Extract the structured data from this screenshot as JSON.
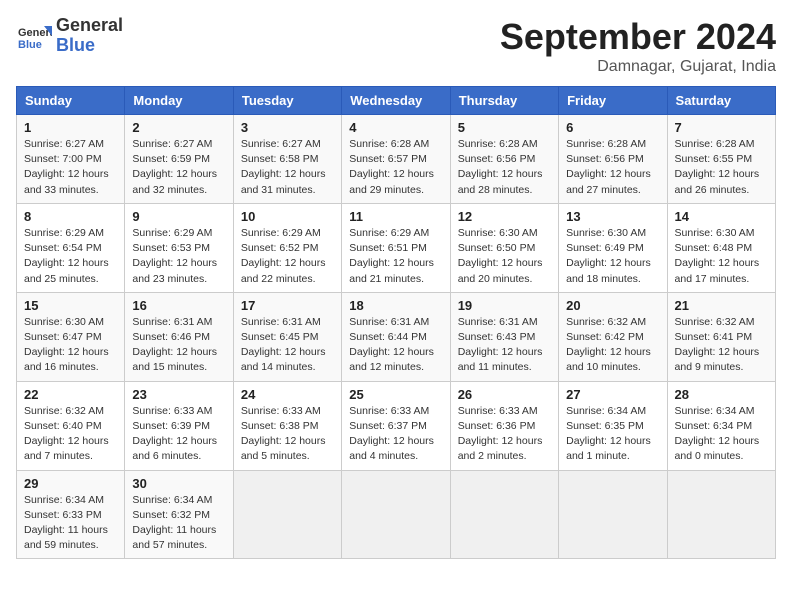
{
  "header": {
    "logo_line1": "General",
    "logo_line2": "Blue",
    "month": "September 2024",
    "location": "Damnagar, Gujarat, India"
  },
  "columns": [
    "Sunday",
    "Monday",
    "Tuesday",
    "Wednesday",
    "Thursday",
    "Friday",
    "Saturday"
  ],
  "weeks": [
    [
      {
        "day": "1",
        "info": "Sunrise: 6:27 AM\nSunset: 7:00 PM\nDaylight: 12 hours\nand 33 minutes."
      },
      {
        "day": "2",
        "info": "Sunrise: 6:27 AM\nSunset: 6:59 PM\nDaylight: 12 hours\nand 32 minutes."
      },
      {
        "day": "3",
        "info": "Sunrise: 6:27 AM\nSunset: 6:58 PM\nDaylight: 12 hours\nand 31 minutes."
      },
      {
        "day": "4",
        "info": "Sunrise: 6:28 AM\nSunset: 6:57 PM\nDaylight: 12 hours\nand 29 minutes."
      },
      {
        "day": "5",
        "info": "Sunrise: 6:28 AM\nSunset: 6:56 PM\nDaylight: 12 hours\nand 28 minutes."
      },
      {
        "day": "6",
        "info": "Sunrise: 6:28 AM\nSunset: 6:56 PM\nDaylight: 12 hours\nand 27 minutes."
      },
      {
        "day": "7",
        "info": "Sunrise: 6:28 AM\nSunset: 6:55 PM\nDaylight: 12 hours\nand 26 minutes."
      }
    ],
    [
      {
        "day": "8",
        "info": "Sunrise: 6:29 AM\nSunset: 6:54 PM\nDaylight: 12 hours\nand 25 minutes."
      },
      {
        "day": "9",
        "info": "Sunrise: 6:29 AM\nSunset: 6:53 PM\nDaylight: 12 hours\nand 23 minutes."
      },
      {
        "day": "10",
        "info": "Sunrise: 6:29 AM\nSunset: 6:52 PM\nDaylight: 12 hours\nand 22 minutes."
      },
      {
        "day": "11",
        "info": "Sunrise: 6:29 AM\nSunset: 6:51 PM\nDaylight: 12 hours\nand 21 minutes."
      },
      {
        "day": "12",
        "info": "Sunrise: 6:30 AM\nSunset: 6:50 PM\nDaylight: 12 hours\nand 20 minutes."
      },
      {
        "day": "13",
        "info": "Sunrise: 6:30 AM\nSunset: 6:49 PM\nDaylight: 12 hours\nand 18 minutes."
      },
      {
        "day": "14",
        "info": "Sunrise: 6:30 AM\nSunset: 6:48 PM\nDaylight: 12 hours\nand 17 minutes."
      }
    ],
    [
      {
        "day": "15",
        "info": "Sunrise: 6:30 AM\nSunset: 6:47 PM\nDaylight: 12 hours\nand 16 minutes."
      },
      {
        "day": "16",
        "info": "Sunrise: 6:31 AM\nSunset: 6:46 PM\nDaylight: 12 hours\nand 15 minutes."
      },
      {
        "day": "17",
        "info": "Sunrise: 6:31 AM\nSunset: 6:45 PM\nDaylight: 12 hours\nand 14 minutes."
      },
      {
        "day": "18",
        "info": "Sunrise: 6:31 AM\nSunset: 6:44 PM\nDaylight: 12 hours\nand 12 minutes."
      },
      {
        "day": "19",
        "info": "Sunrise: 6:31 AM\nSunset: 6:43 PM\nDaylight: 12 hours\nand 11 minutes."
      },
      {
        "day": "20",
        "info": "Sunrise: 6:32 AM\nSunset: 6:42 PM\nDaylight: 12 hours\nand 10 minutes."
      },
      {
        "day": "21",
        "info": "Sunrise: 6:32 AM\nSunset: 6:41 PM\nDaylight: 12 hours\nand 9 minutes."
      }
    ],
    [
      {
        "day": "22",
        "info": "Sunrise: 6:32 AM\nSunset: 6:40 PM\nDaylight: 12 hours\nand 7 minutes."
      },
      {
        "day": "23",
        "info": "Sunrise: 6:33 AM\nSunset: 6:39 PM\nDaylight: 12 hours\nand 6 minutes."
      },
      {
        "day": "24",
        "info": "Sunrise: 6:33 AM\nSunset: 6:38 PM\nDaylight: 12 hours\nand 5 minutes."
      },
      {
        "day": "25",
        "info": "Sunrise: 6:33 AM\nSunset: 6:37 PM\nDaylight: 12 hours\nand 4 minutes."
      },
      {
        "day": "26",
        "info": "Sunrise: 6:33 AM\nSunset: 6:36 PM\nDaylight: 12 hours\nand 2 minutes."
      },
      {
        "day": "27",
        "info": "Sunrise: 6:34 AM\nSunset: 6:35 PM\nDaylight: 12 hours\nand 1 minute."
      },
      {
        "day": "28",
        "info": "Sunrise: 6:34 AM\nSunset: 6:34 PM\nDaylight: 12 hours\nand 0 minutes."
      }
    ],
    [
      {
        "day": "29",
        "info": "Sunrise: 6:34 AM\nSunset: 6:33 PM\nDaylight: 11 hours\nand 59 minutes."
      },
      {
        "day": "30",
        "info": "Sunrise: 6:34 AM\nSunset: 6:32 PM\nDaylight: 11 hours\nand 57 minutes."
      },
      {
        "day": "",
        "info": ""
      },
      {
        "day": "",
        "info": ""
      },
      {
        "day": "",
        "info": ""
      },
      {
        "day": "",
        "info": ""
      },
      {
        "day": "",
        "info": ""
      }
    ]
  ]
}
